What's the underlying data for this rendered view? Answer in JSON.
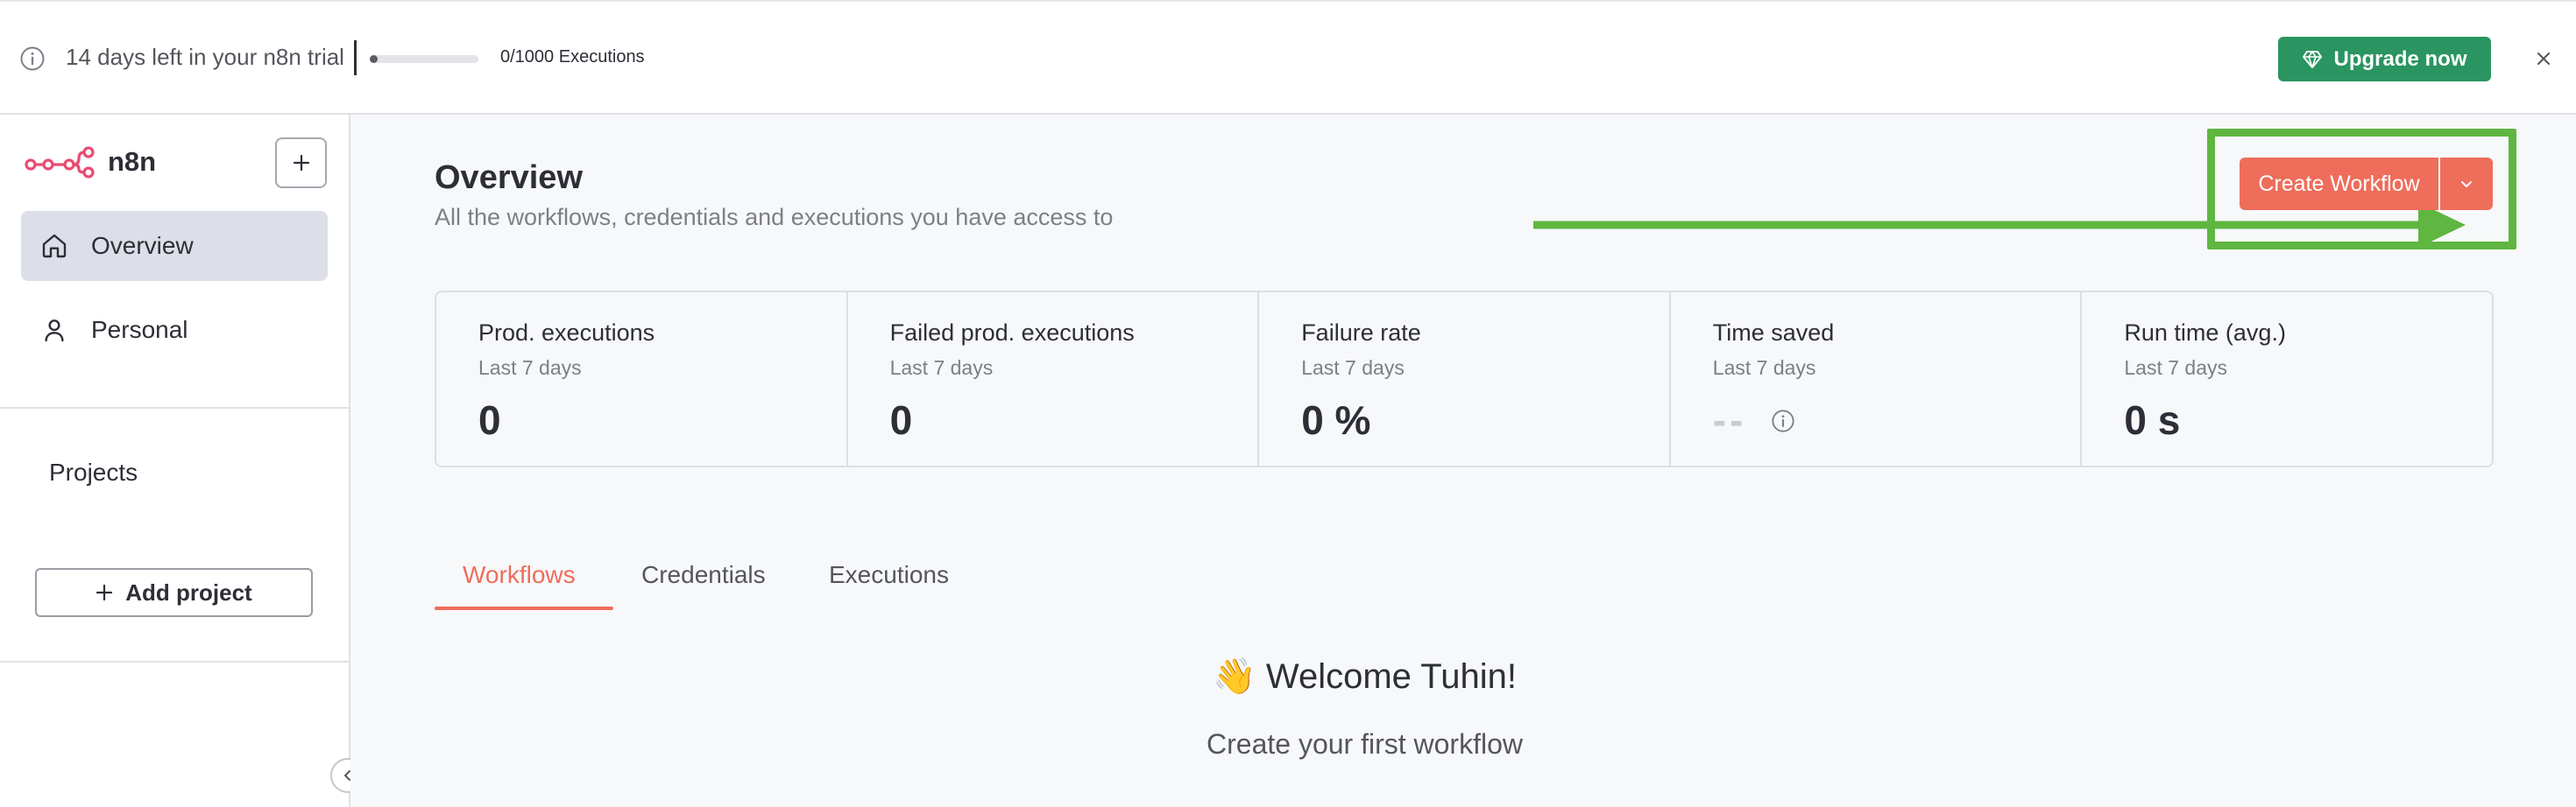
{
  "banner": {
    "trial_text": "14 days left in your n8n trial",
    "executions_label": "0/1000 Executions",
    "executions_progress": 0.0,
    "upgrade_label": "Upgrade now"
  },
  "sidebar": {
    "brand": "n8n",
    "items": [
      {
        "label": "Overview",
        "icon": "home-icon",
        "active": true
      },
      {
        "label": "Personal",
        "icon": "user-icon",
        "active": false
      }
    ],
    "projects_label": "Projects",
    "add_project_label": "Add project"
  },
  "main": {
    "title": "Overview",
    "subtitle": "All the workflows, credentials and executions you have access to",
    "create_button_label": "Create Workflow",
    "stats": [
      {
        "title": "Prod. executions",
        "sub": "Last 7 days",
        "value": "0"
      },
      {
        "title": "Failed prod. executions",
        "sub": "Last 7 days",
        "value": "0"
      },
      {
        "title": "Failure rate",
        "sub": "Last 7 days",
        "value": "0 %"
      },
      {
        "title": "Time saved",
        "sub": "Last 7 days",
        "value": "--"
      },
      {
        "title": "Run time (avg.)",
        "sub": "Last 7 days",
        "value": "0 s"
      }
    ],
    "tabs": [
      "Workflows",
      "Credentials",
      "Executions"
    ],
    "welcome_title": "👋 Welcome Tuhin!",
    "welcome_sub": "Create your first workflow"
  },
  "colors": {
    "accent": "#ee6d5b",
    "upgrade": "#2a9560",
    "highlight": "#5fb640"
  }
}
